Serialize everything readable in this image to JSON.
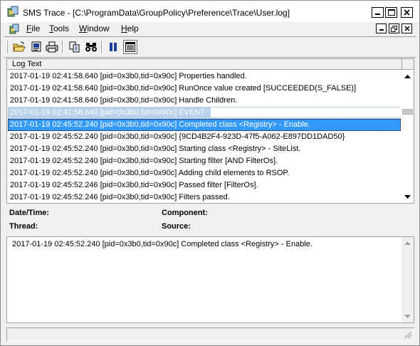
{
  "window": {
    "title": "SMS Trace - [C:\\ProgramData\\GroupPolicy\\Preference\\Trace\\User.log]"
  },
  "menu": {
    "items": [
      {
        "label_first": "F",
        "label_rest": "ile"
      },
      {
        "label_first": "T",
        "label_rest": "ools"
      },
      {
        "label_first": "W",
        "label_rest": "indow"
      },
      {
        "label_first": "H",
        "label_rest": "elp"
      }
    ]
  },
  "toolbar": {
    "buttons": [
      "open-icon",
      "print-preview-icon",
      "print-icon",
      "copy-icon",
      "find-icon",
      "pause-icon",
      "toggle-view-icon"
    ]
  },
  "log": {
    "column_header": "Log Text",
    "rows": [
      "2017-01-19 02:41:58.640 [pid=0x3b0,tid=0x90c] Properties handled.",
      "2017-01-19 02:41:58.640 [pid=0x3b0,tid=0x90c] RunOnce value created [SUCCEEDED(S_FALSE)]",
      "2017-01-19 02:41:58.640 [pid=0x3b0,tid=0x90c] Handle Children.",
      "2017-01-19 02:41:58.640 [pid=0x3b0,tid=0x90c] EVENT :",
      "2017-01-19 02:45:52.240 [pid=0x3b0,tid=0x90c] Completed class <Registry> - Enable.",
      "2017-01-19 02:45:52.240 [pid=0x3b0,tid=0x90c] {9CD4B2F4-923D-47f5-A062-E897DD1DAD50}",
      "2017-01-19 02:45:52.240 [pid=0x3b0,tid=0x90c] Starting class <Registry> - SiteList.",
      "2017-01-19 02:45:52.240 [pid=0x3b0,tid=0x90c] Starting filter [AND FilterOs].",
      "2017-01-19 02:45:52.240 [pid=0x3b0,tid=0x90c] Adding child elements to RSOP.",
      "2017-01-19 02:45:52.246 [pid=0x3b0,tid=0x90c] Passed filter [FilterOs].",
      "2017-01-19 02:45:52.246 [pid=0x3b0,tid=0x90c] Filters passed."
    ],
    "selected_index": 4,
    "dim_index": 3
  },
  "details": {
    "datetime_label": "Date/Time:",
    "component_label": "Component:",
    "thread_label": "Thread:",
    "source_label": "Source:",
    "text": "2017-01-19 02:45:52.240 [pid=0x3b0,tid=0x90c] Completed class <Registry> - Enable."
  },
  "colors": {
    "selection": "#3399ff",
    "selection_inactive": "#b9d1ea",
    "pause_icon": "#1e3e9e"
  }
}
